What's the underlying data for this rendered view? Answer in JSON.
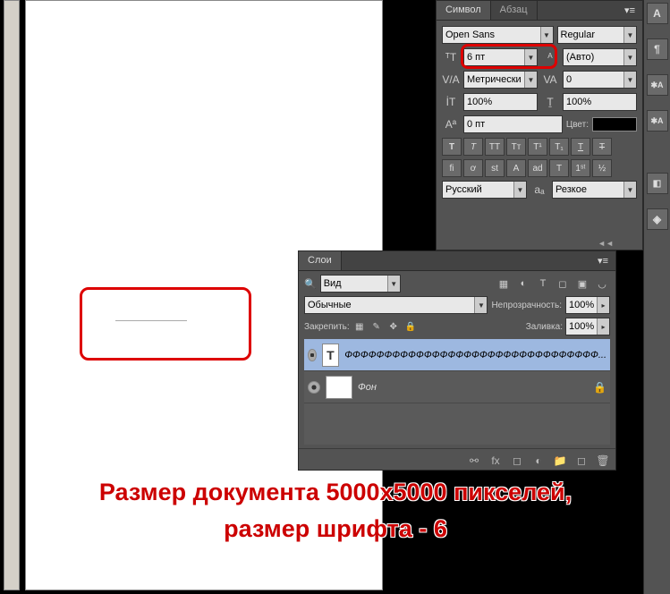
{
  "character_panel": {
    "tab_character": "Символ",
    "tab_paragraph": "Абзац",
    "font_family": "Open Sans",
    "font_style": "Regular",
    "font_size": "6 пт",
    "leading": "(Авто)",
    "kerning": "Метрический",
    "tracking": "0",
    "vscale": "100%",
    "hscale": "100%",
    "baseline": "0 пт",
    "color_label": "Цвет:",
    "language": "Русский",
    "aa_mode": "Резкое"
  },
  "layers_panel": {
    "tab": "Слои",
    "filter_kind": "Вид",
    "blend_mode": "Обычные",
    "opacity_label": "Непрозрачность:",
    "opacity": "100%",
    "lock_label": "Закрепить:",
    "fill_label": "Заливка:",
    "fill": "100%",
    "layers": [
      {
        "name": "ФФФФФФФФФФФФФФФФФФФФФФФФФФФФФФФФ...",
        "icon": "T",
        "selected": true,
        "locked": false
      },
      {
        "name": "Фон",
        "icon": "",
        "selected": false,
        "locked": true
      }
    ]
  },
  "annotation": {
    "line1": "Размер документа 5000х5000 пикселей,",
    "line2": "размер шрифта - 6"
  }
}
